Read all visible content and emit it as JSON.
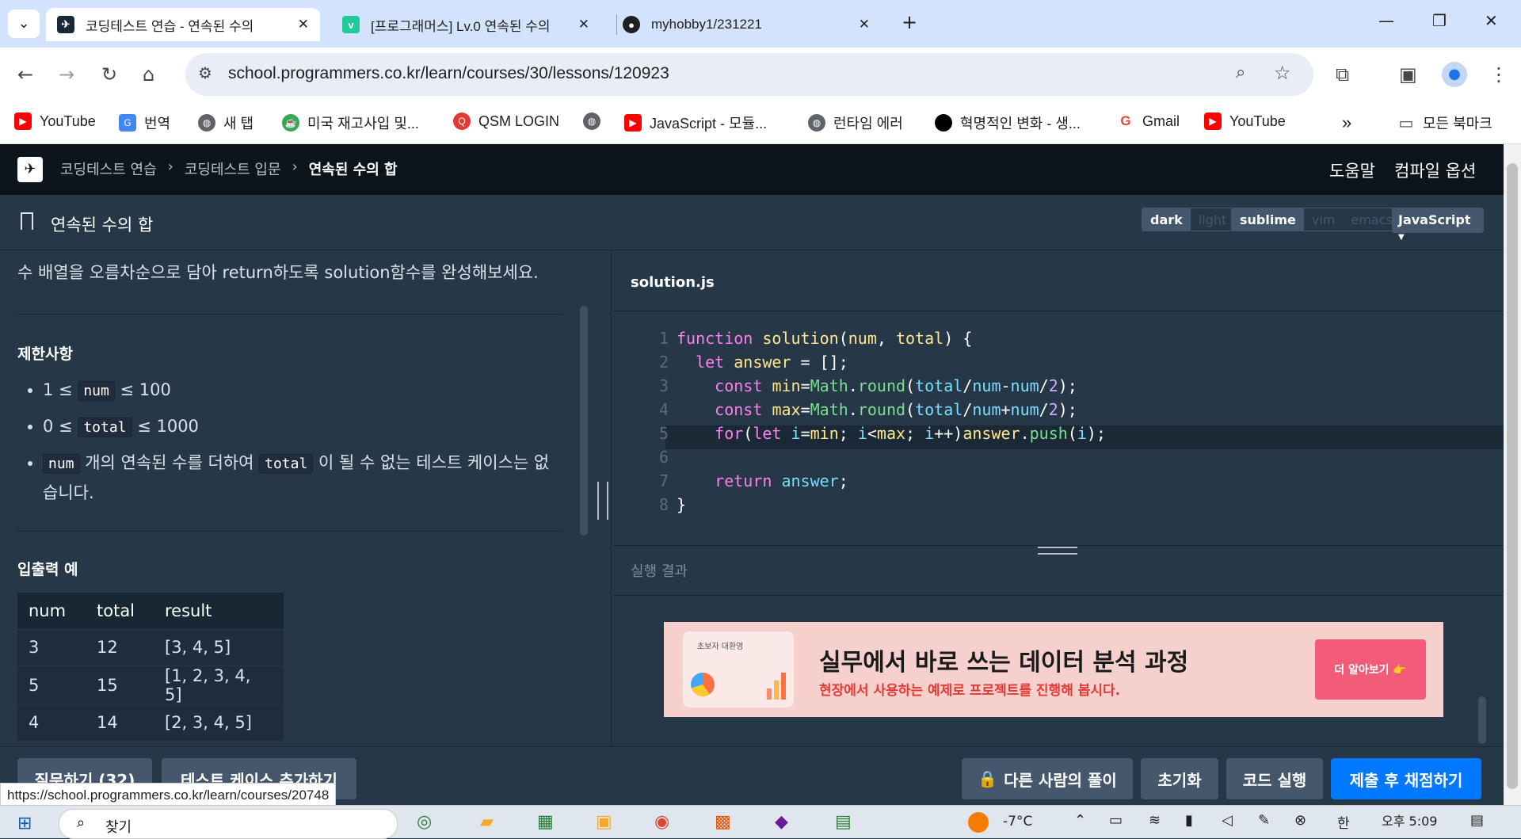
{
  "browser": {
    "tabs": [
      {
        "title": "코딩테스트 연습 - 연속된 수의",
        "active": true
      },
      {
        "title": "[프로그래머스] Lv.0 연속된 수의",
        "active": false
      },
      {
        "title": "myhobby1/231221",
        "active": false
      }
    ],
    "url": "school.programmers.co.kr/learn/courses/30/lessons/120923",
    "bookmarks": [
      "YouTube",
      "번역",
      "새 탭",
      "미국 재고사입 및...",
      "QSM LOGIN",
      "",
      "JavaScript - 모듈...",
      "런타임 에러",
      "혁명적인 변화 - 생...",
      "Gmail",
      "YouTube"
    ],
    "all_bookmarks": "모든 북마크"
  },
  "header": {
    "crumbs": [
      "코딩테스트 연습",
      "코딩테스트 입문",
      "연속된 수의 합"
    ],
    "help": "도움말",
    "compile_options": "컴파일 옵션"
  },
  "problem": {
    "title": "연속된 수의 합",
    "theme": [
      "dark",
      "light"
    ],
    "keymap": [
      "sublime",
      "vim",
      "emacs"
    ],
    "language": "JavaScript",
    "intro": "수 배열을 오름차순으로 담아 return하도록 solution함수를 완성해보세요.",
    "constraints_title": "제한사항",
    "c1": {
      "a": "1 ≤",
      "code": "num",
      "b": "≤ 100"
    },
    "c2": {
      "a": "0 ≤",
      "code": "total",
      "b": "≤ 1000"
    },
    "c3": {
      "code1": "num",
      "a": "개의 연속된 수를 더하여",
      "code2": "total",
      "b": "이 될 수 없는 테스트 케이스는 없습니다."
    },
    "io_title": "입출력 예",
    "table": {
      "headers": [
        "num",
        "total",
        "result"
      ],
      "rows": [
        [
          "3",
          "12",
          "[3, 4, 5]"
        ],
        [
          "5",
          "15",
          "[1, 2, 3, 4, 5]"
        ],
        [
          "4",
          "14",
          "[2, 3, 4, 5]"
        ]
      ]
    }
  },
  "editor": {
    "filename": "solution.js",
    "lines": [
      "function solution(num, total) {",
      "  let answer = [];",
      "    const min=Math.round(total/num-num/2);",
      "    const max=Math.round(total/num+num/2);",
      "    for(let i=min; i<max; i++)answer.push(i);",
      "",
      "    return answer;",
      "}"
    ],
    "result_label": "실행 결과",
    "banner": {
      "tag": "초보자 대환영",
      "headline": "실무에서 바로 쓰는 데이터 분석 과정",
      "sub": "현장에서 사용하는 예제로 프로젝트를 진행해 봅시다.",
      "cta": "더 알아보기 👉"
    }
  },
  "actions": {
    "ask": "질문하기 (32)",
    "add_test": "테스트 케이스 추가하기",
    "others": "다른 사람의 풀이",
    "reset": "초기화",
    "run": "코드 실행",
    "submit": "제출 후 채점하기"
  },
  "status_url": "https://school.programmers.co.kr/learn/courses/20748",
  "taskbar": {
    "search": "찾기",
    "weather": "-7°C",
    "ime": "한",
    "time": "오후 5:09"
  },
  "colors": {
    "accent": "#0078ff",
    "bg": "#263747",
    "header": "#0c151c"
  }
}
